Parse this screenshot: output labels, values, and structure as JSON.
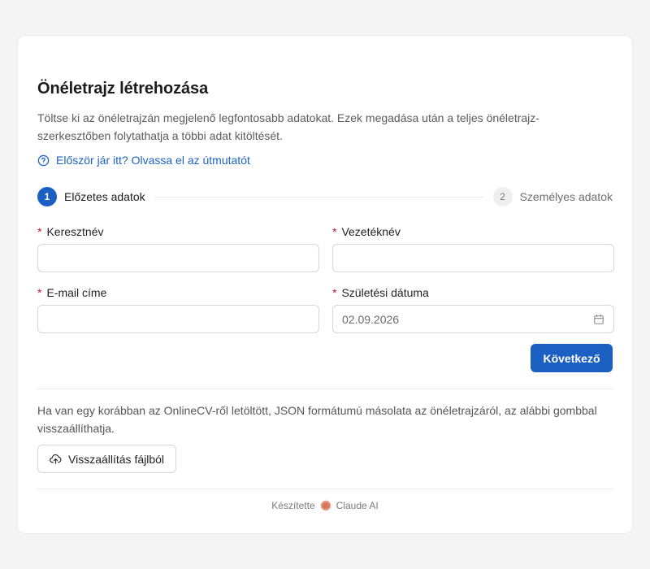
{
  "form": {
    "title": "Önéletrajz létrehozása",
    "intro": "Töltse ki az önéletrajzán megjelenő legfontosabb adatokat. Ezek megadása után a teljes önéletrajz-szerkesztőben folytathatja a többi adat kitöltését.",
    "help_link": "Először jár itt? Olvassa el az útmutatót"
  },
  "steps": [
    {
      "number": "1",
      "label": "Előzetes adatok",
      "state": "active"
    },
    {
      "number": "2",
      "label": "Személyes adatok",
      "state": "inactive"
    }
  ],
  "fields": {
    "first_name": {
      "label": "Keresztnév",
      "required_mark": "*",
      "value": ""
    },
    "last_name": {
      "label": "Vezetéknév",
      "required_mark": "*",
      "value": ""
    },
    "email": {
      "label": "E-mail címe",
      "required_mark": "*",
      "value": ""
    },
    "birth_date": {
      "label": "Születési dátuma",
      "required_mark": "*",
      "value": "02.09.2026"
    }
  },
  "actions": {
    "next_label": "Következő",
    "restore_text": "Ha van egy korábban az OnlineCV-ről letöltött, JSON formátumú másolata az önéletrajzáról, az alábbi gombbal visszaállíthatja.",
    "restore_label": "Visszaállítás fájlból"
  },
  "footer": {
    "made_by": "Készítette",
    "brand": "Claude AI"
  },
  "colors": {
    "accent": "#1c5fc2",
    "link": "#1d63c3",
    "required": "#c0162b",
    "brand_logo": "#d97757"
  },
  "icons": {
    "help": "question-circle-icon",
    "calendar": "calendar-icon",
    "upload": "cloud-upload-icon",
    "brand": "claude-logo-icon"
  }
}
